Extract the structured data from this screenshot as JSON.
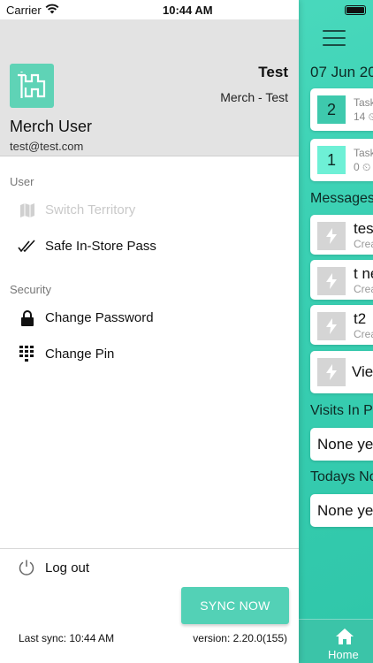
{
  "status_bar": {
    "carrier": "Carrier",
    "time": "10:44 AM"
  },
  "profile": {
    "company": "Test",
    "role": "Merch - Test",
    "user_name": "Merch User",
    "email": "test@test.com"
  },
  "menu": {
    "user_section": "User",
    "switch_territory": "Switch Territory",
    "safe_pass": "Safe In-Store Pass",
    "security_section": "Security",
    "change_password": "Change Password",
    "change_pin": "Change Pin"
  },
  "footer": {
    "logout": "Log out",
    "sync_button": "SYNC NOW",
    "last_sync": "Last sync: 10:44 AM",
    "version": "version: 2.20.0(155)"
  },
  "main_screen": {
    "date": "07 Jun 20",
    "tasks": [
      {
        "count": "2",
        "title": "Task",
        "sub": "14 ⏲"
      },
      {
        "count": "1",
        "title": "Task",
        "sub": "0 ⏲"
      }
    ],
    "messages_heading": "Messages",
    "messages": [
      {
        "title": "tes",
        "sub": "Crea"
      },
      {
        "title": "t ne",
        "sub": "Crea"
      },
      {
        "title": "t2",
        "sub": "Crea"
      }
    ],
    "view_label": "View",
    "visits_heading": "Visits In P",
    "visits_none": "None ye",
    "todays_heading": "Todays No",
    "todays_none": "None ye",
    "home_tab": "Home"
  },
  "colors": {
    "accent": "#53d1b6",
    "main_background": "#3ad0b3",
    "count_primary": "#3ec9ad",
    "count_secondary": "#6ef0d6"
  }
}
